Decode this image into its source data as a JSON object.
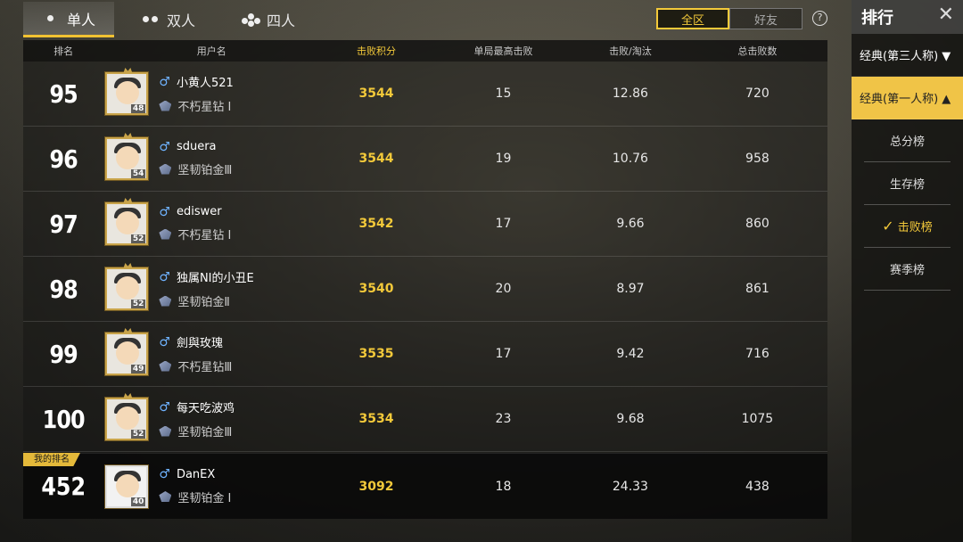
{
  "tabs": [
    {
      "label": "单人",
      "active": true
    },
    {
      "label": "双人",
      "active": false
    },
    {
      "label": "四人",
      "active": false
    }
  ],
  "scope": {
    "all": "全区",
    "friends": "好友",
    "help": "?"
  },
  "columns": {
    "rank": "排名",
    "user": "用户名",
    "score": "击败积分",
    "best": "单局最高击败",
    "kd": "击败/淘汰",
    "total": "总击败数"
  },
  "rows": [
    {
      "rank": "95",
      "level": "48",
      "name": "小黄人521",
      "tier": "不朽星钻 I",
      "score": "3544",
      "best": "15",
      "kd": "12.86",
      "total": "720"
    },
    {
      "rank": "96",
      "level": "54",
      "name": "sduera",
      "tier": "坚韧铂金Ⅲ",
      "score": "3544",
      "best": "19",
      "kd": "10.76",
      "total": "958"
    },
    {
      "rank": "97",
      "level": "52",
      "name": "ediswer",
      "tier": "不朽星钻 I",
      "score": "3542",
      "best": "17",
      "kd": "9.66",
      "total": "860"
    },
    {
      "rank": "98",
      "level": "52",
      "name": "独属NI的小丑E",
      "tier": "坚韧铂金Ⅱ",
      "score": "3540",
      "best": "20",
      "kd": "8.97",
      "total": "861"
    },
    {
      "rank": "99",
      "level": "49",
      "name": "劍與玫瑰",
      "tier": "不朽星钻Ⅲ",
      "score": "3535",
      "best": "17",
      "kd": "9.42",
      "total": "716"
    },
    {
      "rank": "100",
      "level": "52",
      "name": "每天吃波鸡",
      "tier": "坚韧铂金Ⅲ",
      "score": "3534",
      "best": "23",
      "kd": "9.68",
      "total": "1075"
    }
  ],
  "my_rank": {
    "badge": "我的排名",
    "rank": "452",
    "level": "40",
    "name": "DanEX",
    "tier": "坚韧铂金 I",
    "score": "3092",
    "best": "18",
    "kd": "24.33",
    "total": "438"
  },
  "sidebar": {
    "title": "排行",
    "close": "✕",
    "cat_tpp": "经典(第三人称) ▼",
    "cat_fpp": "经典(第一人称) ▲",
    "items": [
      "总分榜",
      "生存榜",
      "击败榜",
      "赛季榜"
    ],
    "selected_index": 2
  },
  "accent_color": "#f3c93a"
}
